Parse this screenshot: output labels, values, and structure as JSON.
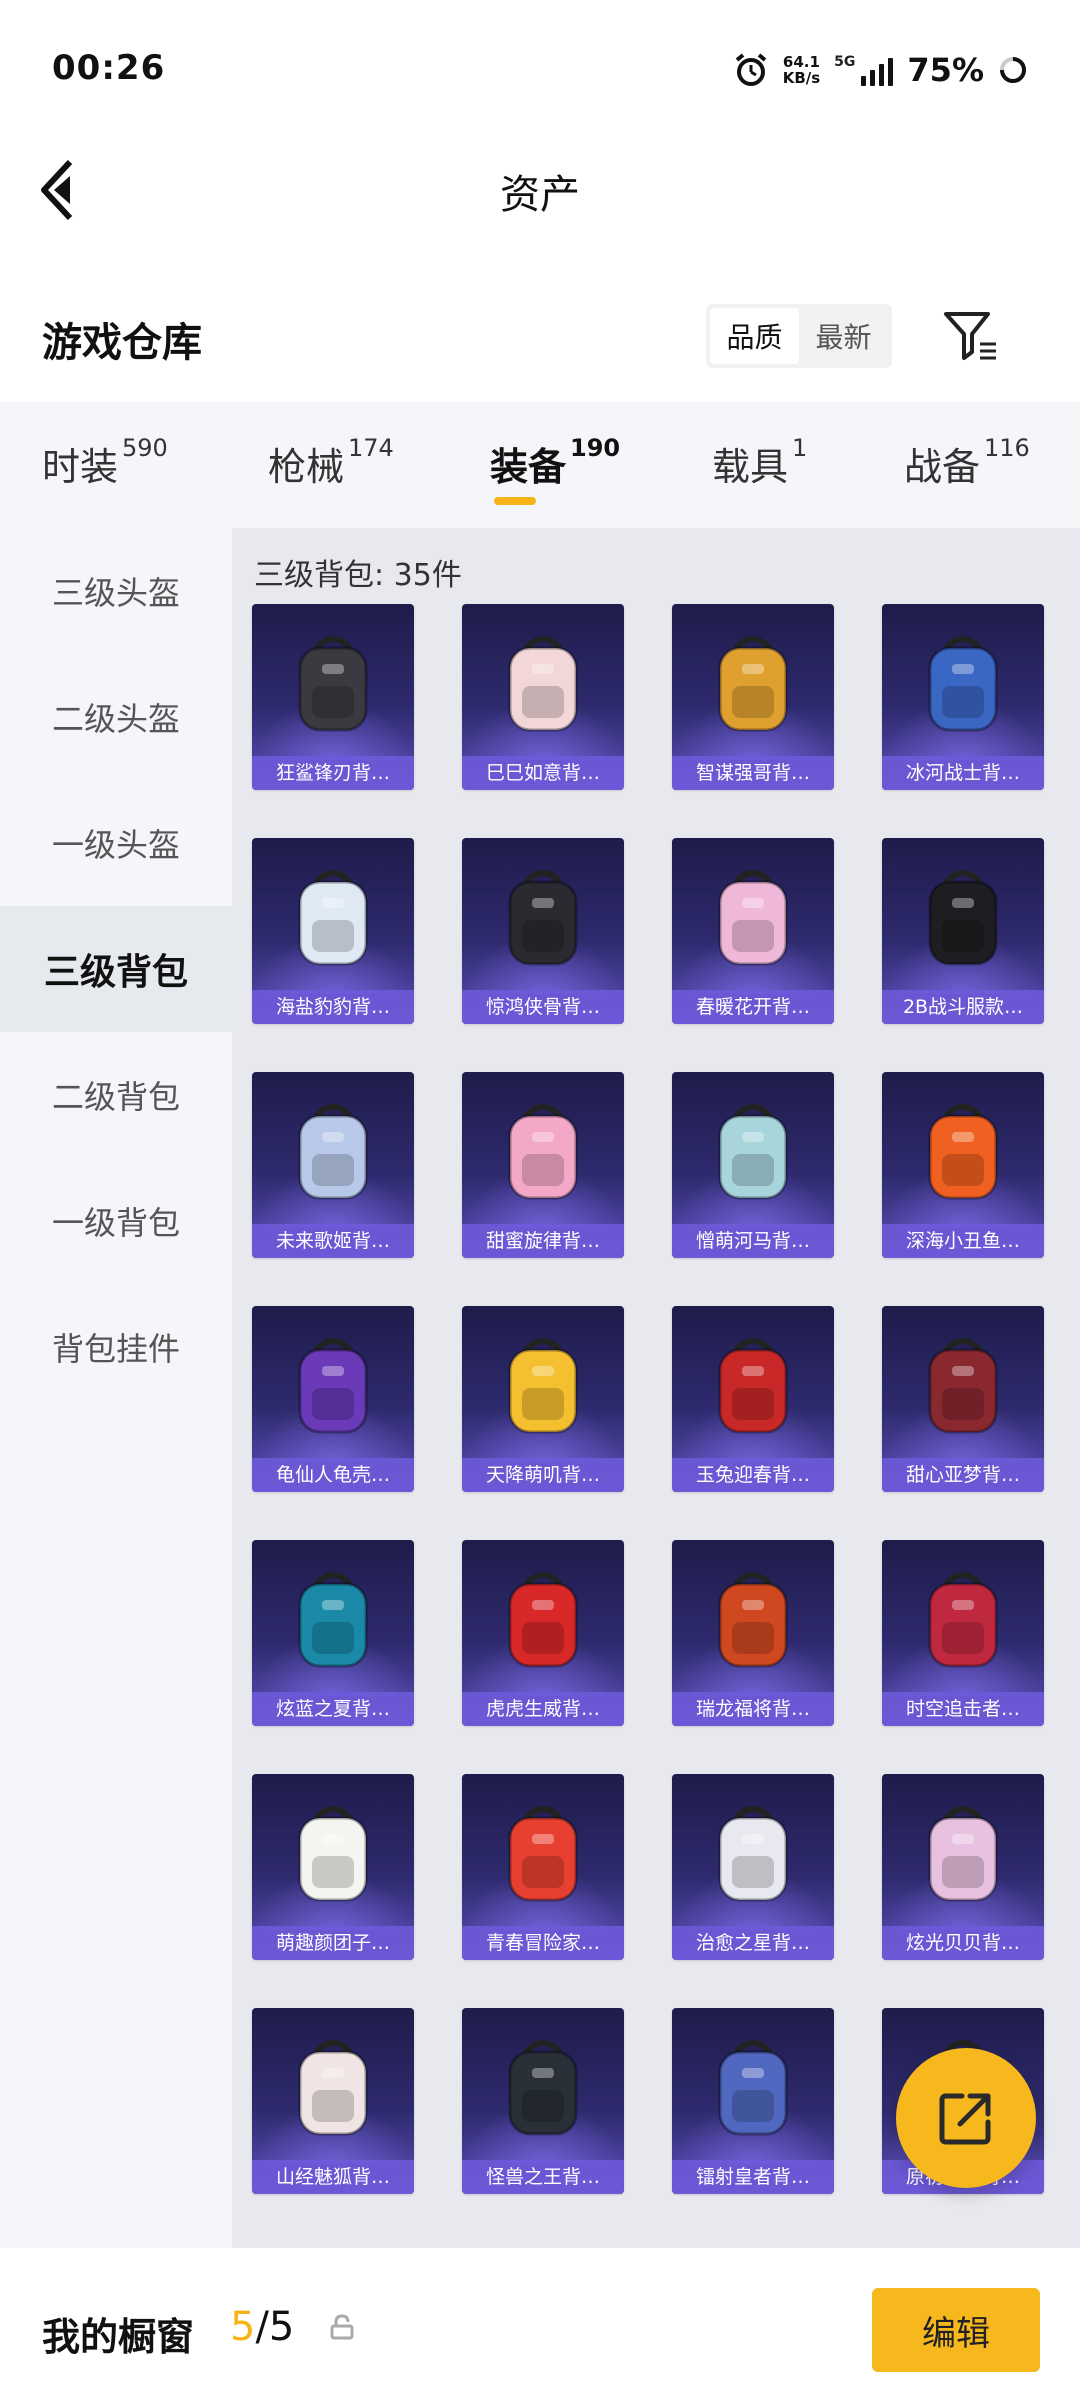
{
  "status_bar": {
    "time": "00:26",
    "net_speed_value": "64.1",
    "net_speed_unit": "KB/s",
    "network_type": "5G",
    "battery": "75%"
  },
  "header": {
    "title": "资产"
  },
  "warehouse": {
    "title": "游戏仓库",
    "sort_options": [
      "品质",
      "最新"
    ],
    "active_sort": "品质"
  },
  "tabs": [
    {
      "label": "时装",
      "count": "590"
    },
    {
      "label": "枪械",
      "count": "174"
    },
    {
      "label": "装备",
      "count": "190",
      "active": true
    },
    {
      "label": "载具",
      "count": "1"
    },
    {
      "label": "战备",
      "count": "116"
    }
  ],
  "sidebar": [
    {
      "label": "三级头盔"
    },
    {
      "label": "二级头盔"
    },
    {
      "label": "一级头盔"
    },
    {
      "label": "三级背包",
      "active": true
    },
    {
      "label": "二级背包"
    },
    {
      "label": "一级背包"
    },
    {
      "label": "背包挂件"
    }
  ],
  "content": {
    "header": "三级背包: 35件",
    "items": [
      {
        "name": "狂鲨锋刃背…",
        "color": "#3a3a40"
      },
      {
        "name": "巳巳如意背…",
        "color": "#f2d6d8"
      },
      {
        "name": "智谋强哥背…",
        "color": "#e0a030"
      },
      {
        "name": "冰河战士背…",
        "color": "#3a66c4"
      },
      {
        "name": "海盐豹豹背…",
        "color": "#dfe9f3"
      },
      {
        "name": "惊鸿侠骨背…",
        "color": "#2a2a30"
      },
      {
        "name": "春暖花开背…",
        "color": "#f0b8d8"
      },
      {
        "name": "2B战斗服款…",
        "color": "#1e1e22"
      },
      {
        "name": "未来歌姬背…",
        "color": "#b8c8e8"
      },
      {
        "name": "甜蜜旋律背…",
        "color": "#f4a8c8"
      },
      {
        "name": "憎萌河马背…",
        "color": "#a8d4dc"
      },
      {
        "name": "深海小丑鱼…",
        "color": "#f06020"
      },
      {
        "name": "龟仙人龟壳…",
        "color": "#6a3ab8"
      },
      {
        "name": "天降萌叽背…",
        "color": "#f4c030"
      },
      {
        "name": "玉兔迎春背…",
        "color": "#c82828"
      },
      {
        "name": "甜心亚梦背…",
        "color": "#8a2830"
      },
      {
        "name": "炫蓝之夏背…",
        "color": "#1a8aa8"
      },
      {
        "name": "虎虎生威背…",
        "color": "#d82828"
      },
      {
        "name": "瑞龙福将背…",
        "color": "#d04820"
      },
      {
        "name": "时空追击者…",
        "color": "#c02840"
      },
      {
        "name": "萌趣颜团子…",
        "color": "#f4f4f0"
      },
      {
        "name": "青春冒险家…",
        "color": "#e84030"
      },
      {
        "name": "治愈之星背…",
        "color": "#e8e8f0"
      },
      {
        "name": "炫光贝贝背…",
        "color": "#e8c0e0"
      },
      {
        "name": "山经魅狐背…",
        "color": "#f0e4e4"
      },
      {
        "name": "怪兽之王背…",
        "color": "#2a3038"
      },
      {
        "name": "镭射皇者背…",
        "color": "#5068c0"
      },
      {
        "name": "原初圣火背…",
        "color": "#6a4a30"
      }
    ]
  },
  "bottom_bar": {
    "showcase_label": "我的橱窗",
    "showcase_current": "5",
    "showcase_total": "/5",
    "edit_label": "编辑"
  },
  "colors": {
    "accent": "#f7b81d",
    "item_card_top": "#1e1c4a",
    "item_card_bottom": "#5a4fb8",
    "label_strip": "#6e5adc"
  }
}
